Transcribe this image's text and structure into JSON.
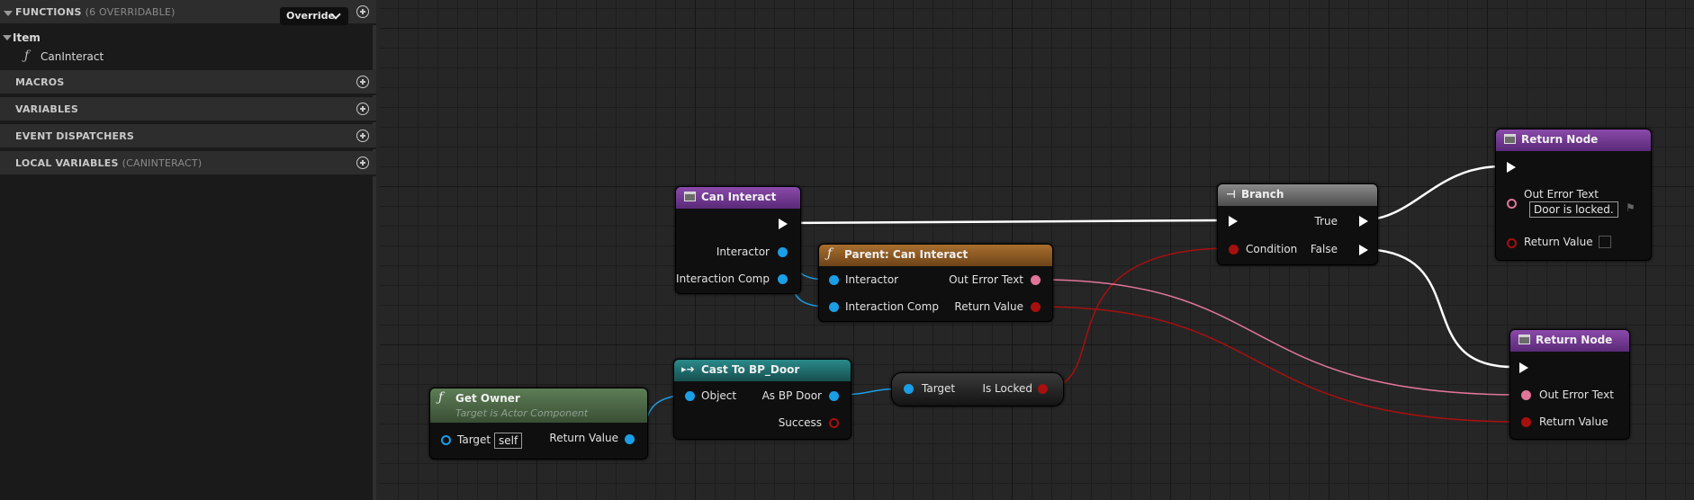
{
  "sidebar": {
    "functions": {
      "label": "FUNCTIONS",
      "sublabel": "(6 OVERRIDABLE)",
      "override_label": "Override"
    },
    "group": {
      "label": "Item",
      "items": [
        {
          "label": "CanInteract"
        }
      ]
    },
    "sections": [
      {
        "label": "MACROS",
        "sublabel": ""
      },
      {
        "label": "VARIABLES",
        "sublabel": ""
      },
      {
        "label": "EVENT DISPATCHERS",
        "sublabel": ""
      },
      {
        "label": "LOCAL VARIABLES",
        "sublabel": "(CANINTERACT)"
      }
    ]
  },
  "graph": {
    "nodes": {
      "can_interact": {
        "title": "Can Interact",
        "pins": {
          "interactor": "Interactor",
          "interaction_comp": "Interaction Comp"
        }
      },
      "parent_can_interact": {
        "title": "Parent: Can Interact",
        "pins": {
          "interactor": "Interactor",
          "interaction_comp": "Interaction Comp",
          "out_error_text": "Out Error Text",
          "return_value": "Return Value"
        }
      },
      "get_owner": {
        "title": "Get Owner",
        "subtitle": "Target is Actor Component",
        "pins": {
          "target": "Target",
          "target_value": "self",
          "return_value": "Return Value"
        }
      },
      "cast_to": {
        "title": "Cast To BP_Door",
        "pins": {
          "object": "Object",
          "as_bp_door": "As BP Door",
          "success": "Success"
        }
      },
      "is_locked": {
        "pins": {
          "target": "Target",
          "is_locked": "Is Locked"
        }
      },
      "branch": {
        "title": "Branch",
        "pins": {
          "condition": "Condition",
          "true": "True",
          "false": "False"
        }
      },
      "return_top": {
        "title": "Return Node",
        "pins": {
          "out_error_text": "Out Error Text",
          "out_error_value": "Door is locked.",
          "return_value": "Return Value"
        }
      },
      "return_bottom": {
        "title": "Return Node",
        "pins": {
          "out_error_text": "Out Error Text",
          "return_value": "Return Value"
        }
      }
    }
  },
  "colors": {
    "exec": "#ffffff",
    "object": "#1a9ee6",
    "bool": "#a80f0f",
    "text": "#e07598",
    "function_header": "#7a3d9a",
    "parent_header": "#8a5a1e",
    "pure_header": "#4d6b45",
    "cast_header": "#1d6b6b",
    "branch_header": "#6a6a6a"
  },
  "icons": {
    "function_icon": "f-glyph",
    "entry_icon": "function-entry-icon",
    "cast_icon": "cast-arrows-icon",
    "branch_icon": "branch-icon",
    "add_icon": "plus-circle-icon"
  }
}
